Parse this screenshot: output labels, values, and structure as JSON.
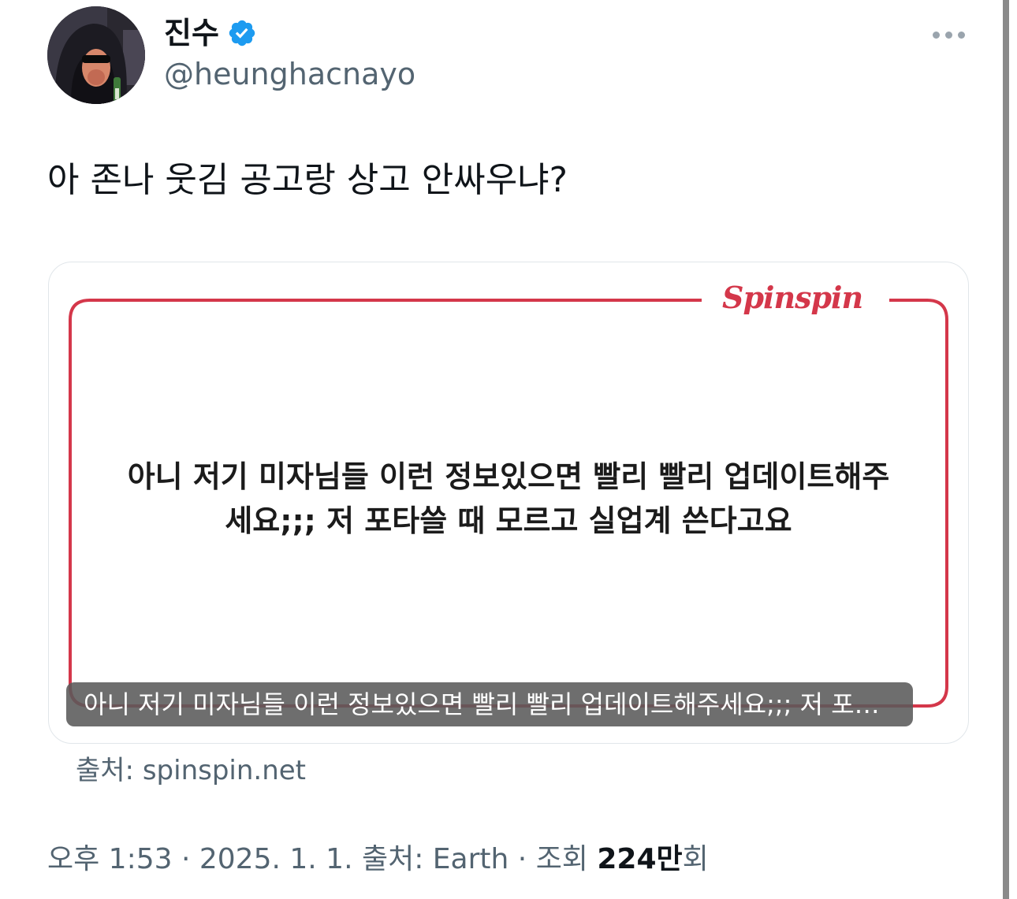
{
  "author": {
    "display_name": "진수",
    "handle": "@heunghacnayo",
    "verified": true,
    "verified_color": "#1d9bf0",
    "avatar_icon": "hooded-figure-sunglasses-avatar"
  },
  "more_icon": "more-horizontal-icon",
  "tweet": {
    "text": "아 존나 웃김 공고랑 상고 안싸우냐?"
  },
  "media": {
    "brand": "Spinspin",
    "brand_color": "#d4374a",
    "body_line_1": "아니 저기 미자님들 이런 정보있으면 빨리 빨리 업데이트해주",
    "body_line_2": "세요;;; 저 포타쓸 때 모르고 실업계 쓴다고요",
    "alt_caption": "아니 저기 미자님들 이런 정보있으면 빨리 빨리 업데이트해주세요;;; 저 포…"
  },
  "source": {
    "prefix": "출처: ",
    "link": "spinspin.net"
  },
  "meta": {
    "time": "오후 1:53",
    "separator": " · ",
    "date": "2025. 1. 1.",
    "client_prefix": " 출처: ",
    "client": "Earth",
    "views_label": "조회 ",
    "views_count": "224만",
    "views_suffix": "회"
  }
}
